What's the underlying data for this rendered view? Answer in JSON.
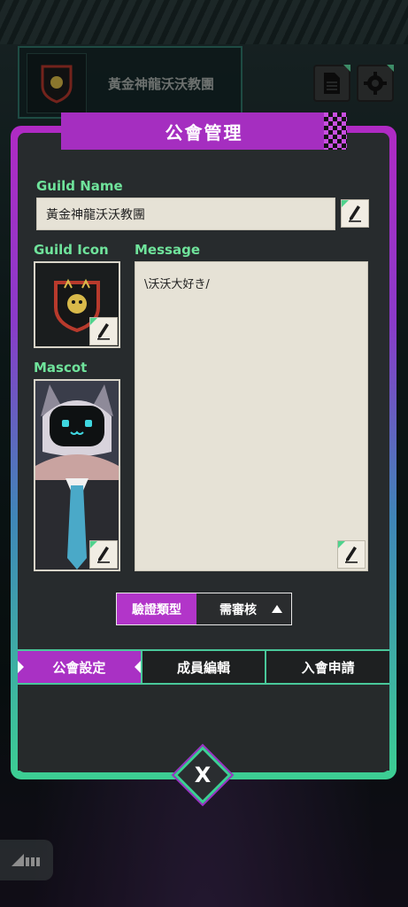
{
  "background": {
    "guild_name": "黃金神龍沃沃教團"
  },
  "header_buttons": {
    "document_icon": "document-icon",
    "settings_icon": "gear-icon"
  },
  "dialog": {
    "title": "公會管理",
    "guild_name_label": "Guild Name",
    "guild_name_value": "黃金神龍沃沃教團",
    "guild_icon_label": "Guild Icon",
    "message_label": "Message",
    "message_value": "\\沃沃大好き/",
    "mascot_label": "Mascot",
    "verify": {
      "label": "驗證類型",
      "value": "需審核"
    },
    "tabs": [
      {
        "label": "公會設定",
        "active": true
      },
      {
        "label": "成員編輯",
        "active": false
      },
      {
        "label": "入會申請",
        "active": false
      }
    ],
    "close_label": "X"
  },
  "colors": {
    "accent_purple": "#a931c4",
    "accent_green": "#3ccf93",
    "label_green": "#6fe39b"
  }
}
